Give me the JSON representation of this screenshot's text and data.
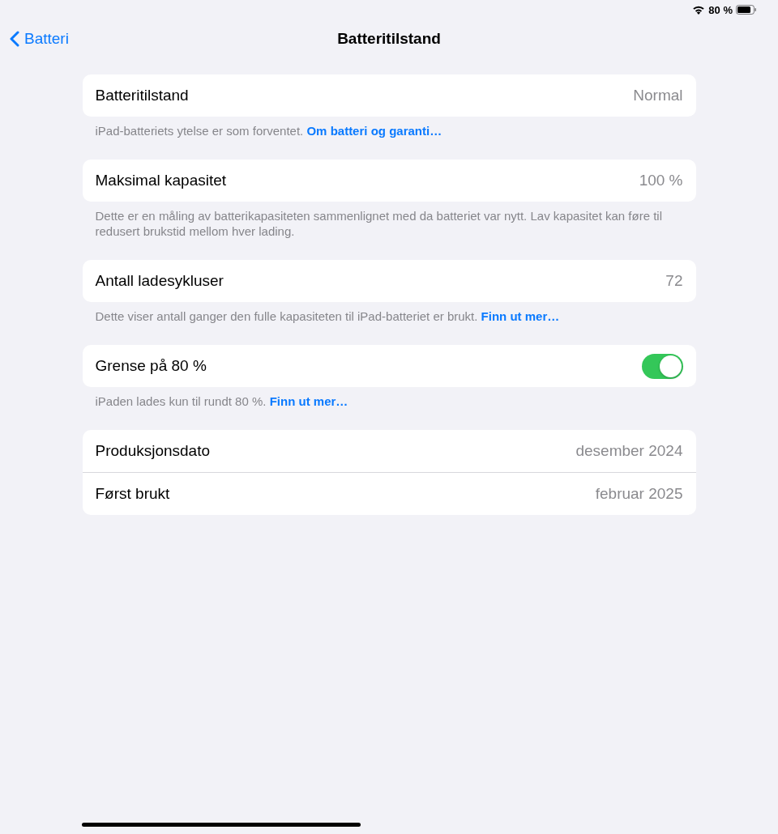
{
  "status_bar": {
    "battery_text": "80 %"
  },
  "nav": {
    "back": "Batteri",
    "title": "Batteritilstand"
  },
  "sections": [
    {
      "rows": [
        {
          "kind": "value",
          "label": "Batteritilstand",
          "value": "Normal"
        }
      ],
      "footer": {
        "text": "iPad-batteriets ytelse er som forventet.",
        "link": "Om batteri og garanti…"
      }
    },
    {
      "rows": [
        {
          "kind": "value",
          "label": "Maksimal kapasitet",
          "value": "100 %"
        }
      ],
      "footer": {
        "text": "Dette er en måling av batterikapasiteten sammenlignet med da batteriet var nytt. Lav kapasitet kan føre til redusert brukstid mellom hver lading."
      }
    },
    {
      "rows": [
        {
          "kind": "value",
          "label": "Antall ladesykluser",
          "value": "72"
        }
      ],
      "footer": {
        "text": "Dette viser antall ganger den fulle kapasiteten til iPad-batteriet er brukt.",
        "link": "Finn ut mer…"
      }
    },
    {
      "rows": [
        {
          "kind": "toggle",
          "label": "Grense på 80 %",
          "on": true
        }
      ],
      "footer": {
        "text": "iPaden lades kun til rundt 80 %.",
        "link": "Finn ut mer…"
      }
    },
    {
      "rows": [
        {
          "kind": "value",
          "label": "Produksjonsdato",
          "value": "desember 2024"
        },
        {
          "kind": "value",
          "label": "Først brukt",
          "value": "februar 2025"
        }
      ]
    }
  ]
}
